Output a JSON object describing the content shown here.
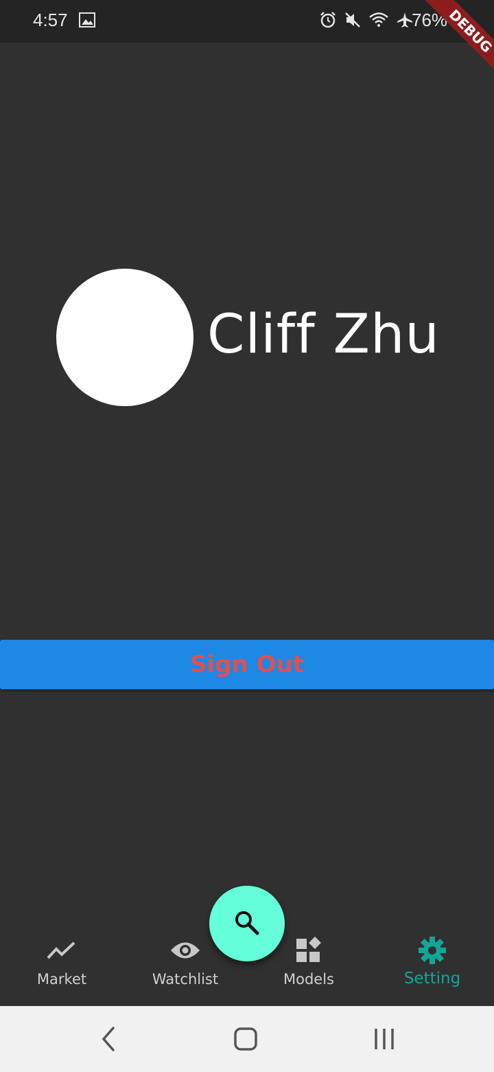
{
  "status_bar": {
    "time": "4:57",
    "battery": "76%",
    "icons": [
      "gallery-icon",
      "alarm-icon",
      "mute-icon",
      "wifi-icon",
      "airplane-icon",
      "battery-icon"
    ]
  },
  "debug_banner": "DEBUG",
  "profile": {
    "name": "Cliff Zhu"
  },
  "signout": {
    "label": "Sign Out",
    "background": "#1e88e5",
    "text_color": "#e05050"
  },
  "fab": {
    "icon": "search-icon",
    "color": "#64ffda"
  },
  "bottom_nav": {
    "items": [
      {
        "label": "Market",
        "icon": "trending-up-icon"
      },
      {
        "label": "Watchlist",
        "icon": "eye-icon"
      },
      {
        "label": "Models",
        "icon": "widgets-icon"
      },
      {
        "label": "Setting",
        "icon": "gear-icon",
        "active": true
      }
    ],
    "active_color": "#12a69a"
  },
  "system_nav": {
    "buttons": [
      "back-icon",
      "home-icon",
      "recents-icon"
    ]
  }
}
